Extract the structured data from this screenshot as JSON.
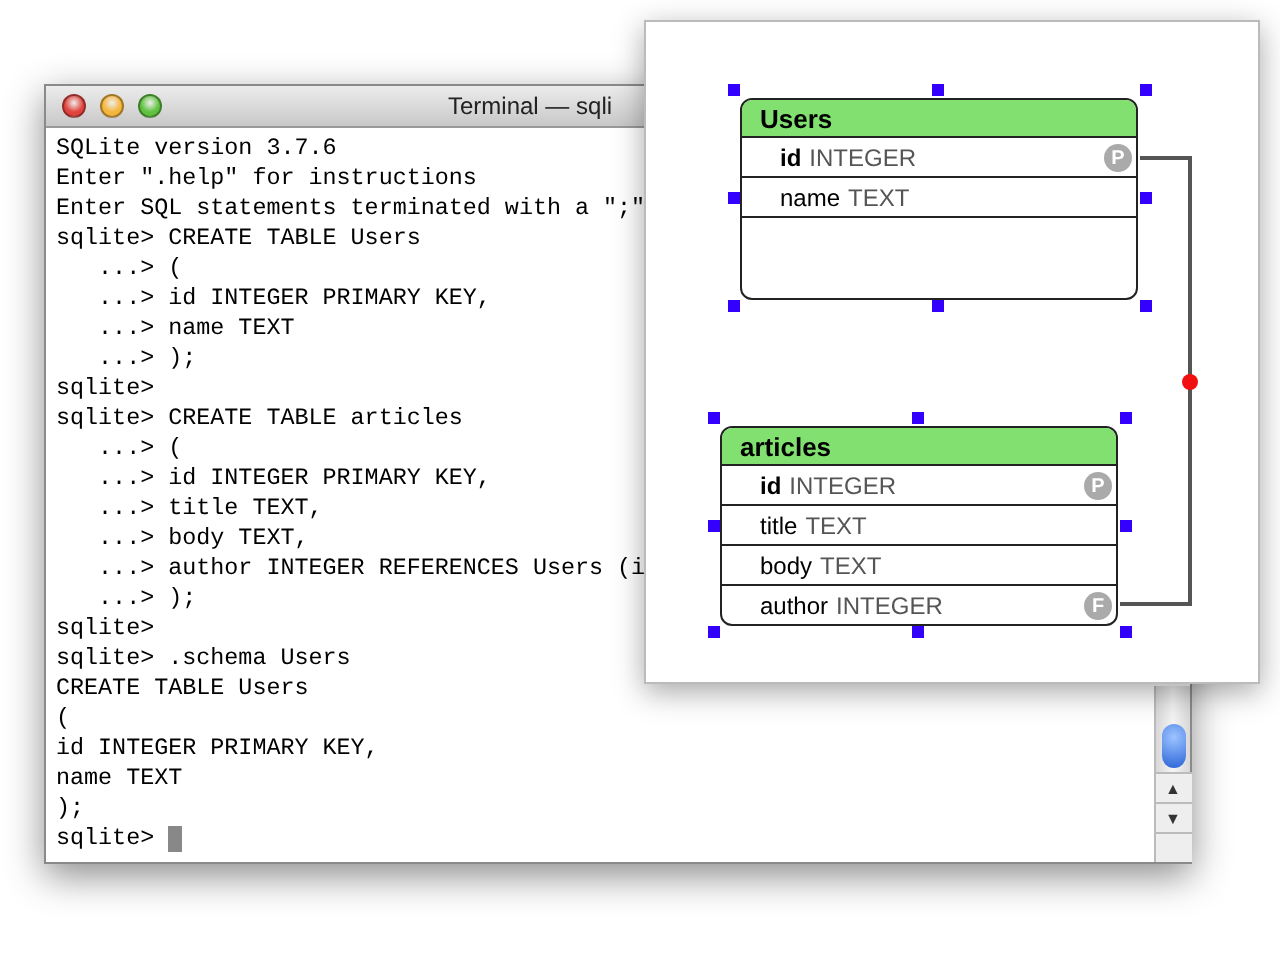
{
  "terminal": {
    "title": "Terminal — sqli",
    "lines": [
      "SQLite version 3.7.6",
      "Enter \".help\" for instructions",
      "Enter SQL statements terminated with a \";\"",
      "sqlite> CREATE TABLE Users",
      "   ...> (",
      "   ...> id INTEGER PRIMARY KEY,",
      "   ...> name TEXT",
      "   ...> );",
      "sqlite>",
      "sqlite> CREATE TABLE articles",
      "   ...> (",
      "   ...> id INTEGER PRIMARY KEY,",
      "   ...> title TEXT,",
      "   ...> body TEXT,",
      "   ...> author INTEGER REFERENCES Users (i",
      "   ...> );",
      "sqlite>",
      "sqlite> .schema Users",
      "CREATE TABLE Users",
      "(",
      "id INTEGER PRIMARY KEY,",
      "name TEXT",
      ");",
      "sqlite> "
    ],
    "scroll_arrows": [
      "▲",
      "▼"
    ]
  },
  "diagram": {
    "tables": [
      {
        "name": "Users",
        "selected": true,
        "columns": [
          {
            "name": "id",
            "type": "INTEGER",
            "primary_key": true,
            "badge": "P"
          },
          {
            "name": "name",
            "type": "TEXT",
            "primary_key": false
          }
        ]
      },
      {
        "name": "articles",
        "selected": true,
        "columns": [
          {
            "name": "id",
            "type": "INTEGER",
            "primary_key": true,
            "badge": "P"
          },
          {
            "name": "title",
            "type": "TEXT",
            "primary_key": false
          },
          {
            "name": "body",
            "type": "TEXT",
            "primary_key": false
          },
          {
            "name": "author",
            "type": "INTEGER",
            "primary_key": false,
            "badge": "F"
          }
        ]
      }
    ]
  }
}
